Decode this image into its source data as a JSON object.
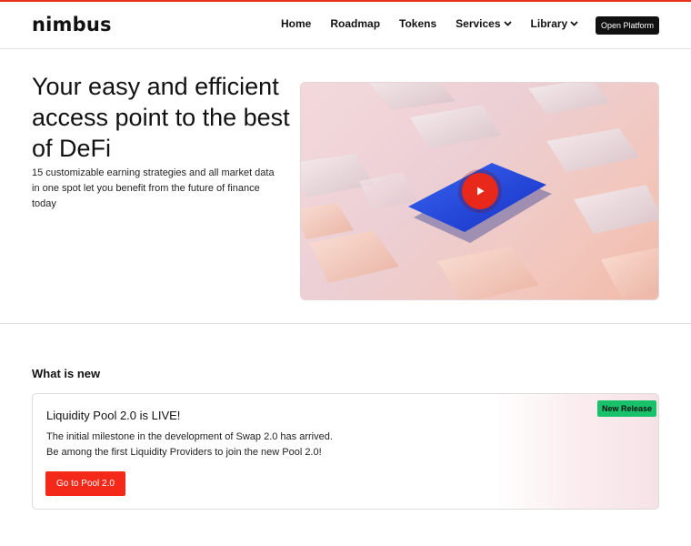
{
  "brand": {
    "logo_text": "nimbus",
    "accent": "#e8321e"
  },
  "nav": {
    "items": [
      {
        "label": "Home"
      },
      {
        "label": "Roadmap"
      },
      {
        "label": "Tokens"
      },
      {
        "label": "Services"
      },
      {
        "label": "Library"
      }
    ],
    "open_platform": "Open Platform"
  },
  "hero": {
    "title": "Your easy and efficient access point to the best of DeFi",
    "subtitle": "15 customizable earning strategies and all market data in one spot let you benefit from the future of finance today",
    "video_icon": "play-icon"
  },
  "news": {
    "heading": "What is new",
    "card": {
      "title": "Liquidity Pool 2.0 is LIVE!",
      "text": "The initial milestone in the development of Swap 2.0 has arrived. Be among the first Liquidity Providers to join the new Pool 2.0!",
      "badge": "New Release",
      "badge_color": "#19c26a",
      "cta": "Go to Pool 2.0",
      "cta_color": "#f5291a"
    }
  }
}
